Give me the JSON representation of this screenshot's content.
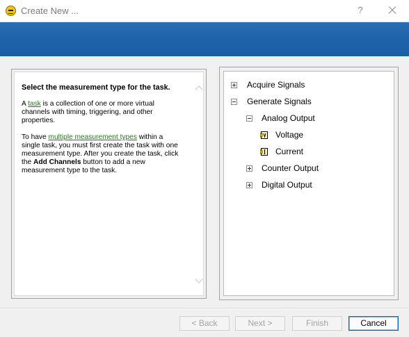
{
  "window": {
    "title": "Create New ...",
    "help_symbol": "?"
  },
  "help": {
    "heading": "Select the measurement type for the task.",
    "p1": {
      "before": "A ",
      "link": "task",
      "after": " is a collection of one or more virtual channels with timing, triggering, and other properties."
    },
    "p2": {
      "before": "To have ",
      "link": "multiple measurement types",
      "mid": " within a single task, you must first create the task with one measurement type. After you create the task, click the ",
      "bold": "Add Channels",
      "after": " button to add a new measurement type to the task."
    }
  },
  "tree": {
    "acquire": "Acquire Signals",
    "generate": "Generate Signals",
    "analog_output": "Analog Output",
    "voltage": "Voltage",
    "current": "Current",
    "counter_output": "Counter Output",
    "digital_output": "Digital Output"
  },
  "buttons": {
    "back": "< Back",
    "next": "Next >",
    "finish": "Finish",
    "cancel": "Cancel"
  },
  "icons": {
    "app": "ni-max-app-icon",
    "voltage": "voltage-output-icon",
    "current": "current-output-icon"
  },
  "colors": {
    "banner": "#1f64ab",
    "link": "#1e7d14"
  }
}
